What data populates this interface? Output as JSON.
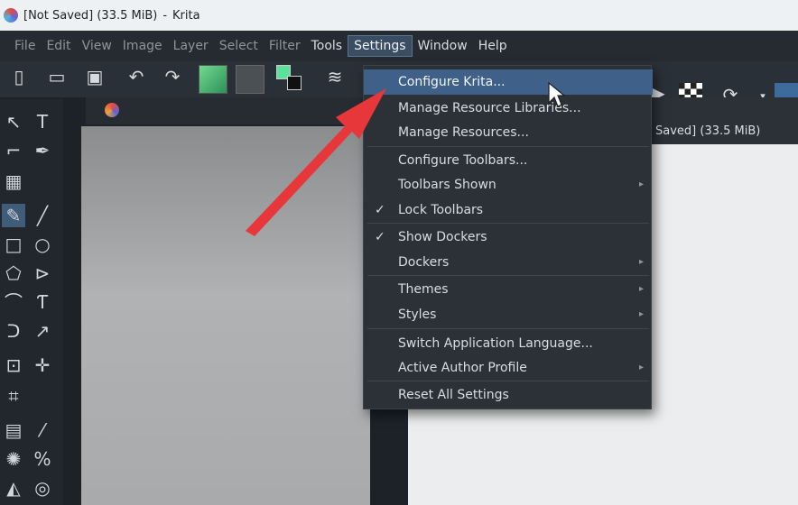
{
  "titlebar": {
    "doc_status": "[Not Saved]",
    "doc_size": "(33.5 MiB)",
    "separator": "-",
    "app_name": "Krita"
  },
  "menubar": {
    "items": [
      {
        "label": "File"
      },
      {
        "label": "Edit"
      },
      {
        "label": "View"
      },
      {
        "label": "Image"
      },
      {
        "label": "Layer"
      },
      {
        "label": "Select"
      },
      {
        "label": "Filter"
      },
      {
        "label": "Tools"
      },
      {
        "label": "Settings"
      },
      {
        "label": "Window"
      },
      {
        "label": "Help"
      }
    ]
  },
  "settings_menu": {
    "items": [
      {
        "label": "Configure Krita..."
      },
      {
        "label": "Manage Resource Libraries..."
      },
      {
        "label": "Manage Resources..."
      },
      {
        "label": "Configure Toolbars..."
      },
      {
        "label": "Toolbars Shown"
      },
      {
        "label": "Lock Toolbars"
      },
      {
        "label": "Show Dockers"
      },
      {
        "label": "Dockers"
      },
      {
        "label": "Themes"
      },
      {
        "label": "Styles"
      },
      {
        "label": "Switch Application Language..."
      },
      {
        "label": "Active Author Profile"
      },
      {
        "label": "Reset All Settings"
      }
    ],
    "check_glyph": "✓",
    "submenu_glyph": "▸"
  },
  "doc_label": "Saved] (33.5 MiB)",
  "colors": {
    "highlight": "#3f6089",
    "arrow": "#e8373a",
    "menu_bg": "#2b3137"
  }
}
